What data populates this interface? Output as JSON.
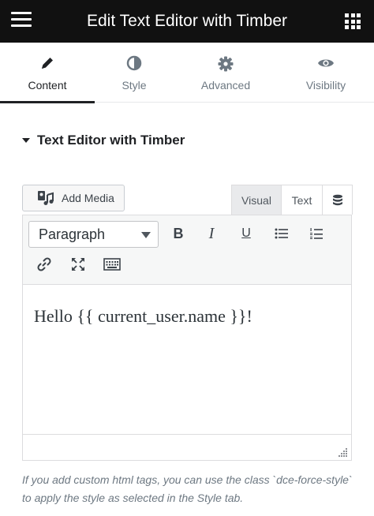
{
  "header": {
    "title": "Edit Text Editor with Timber",
    "menu_icon": "hamburger-icon",
    "apps_icon": "grid-icon",
    "background": "#111111"
  },
  "tabs": [
    {
      "label": "Content",
      "icon": "pencil-icon",
      "active": true
    },
    {
      "label": "Style",
      "icon": "half-circle-icon",
      "active": false
    },
    {
      "label": "Advanced",
      "icon": "gear-icon",
      "active": false
    },
    {
      "label": "Visibility",
      "icon": "eye-icon",
      "active": false
    }
  ],
  "section": {
    "title": "Text Editor with Timber"
  },
  "editor": {
    "add_media_label": "Add Media",
    "modes": {
      "visual": "Visual",
      "text": "Text"
    },
    "format_select": "Paragraph",
    "toolbar": {
      "bold": "B",
      "italic": "I",
      "underline": "U"
    },
    "content": "Hello {{ current_user.name }}!"
  },
  "note": "If you add custom html tags, you can use the class `dce-force-style` to apply the style as selected in the Style tab."
}
